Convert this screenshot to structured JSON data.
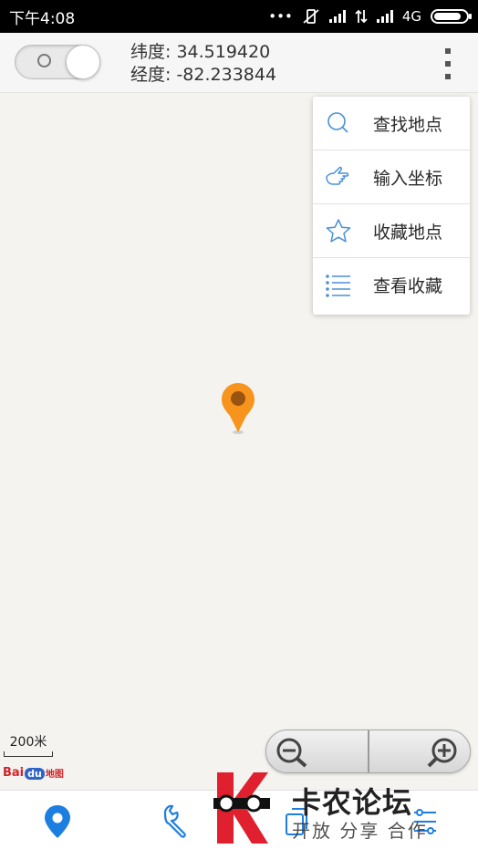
{
  "status_bar": {
    "time": "下午4:08",
    "network": "4G",
    "battery_level": 0.85
  },
  "top_bar": {
    "toggle_label": "O",
    "latitude_text": "纬度: 34.519420",
    "longitude_text": "经度: -82.233844"
  },
  "menu": {
    "items": [
      {
        "label": "查找地点",
        "icon": "search-icon"
      },
      {
        "label": "输入坐标",
        "icon": "pointing-hand-icon"
      },
      {
        "label": "收藏地点",
        "icon": "star-icon"
      },
      {
        "label": "查看收藏",
        "icon": "list-icon"
      }
    ]
  },
  "map": {
    "scale_label": "200米",
    "logo_bai": "Bai",
    "logo_du": "du",
    "logo_map": "地图",
    "marker_color": "#f7941d"
  },
  "bottom_nav": {
    "items": [
      {
        "icon": "location-pin-icon",
        "active": true
      },
      {
        "icon": "wrench-icon",
        "active": false
      },
      {
        "icon": "copy-icon",
        "active": false
      },
      {
        "icon": "filter-list-icon",
        "active": false
      }
    ],
    "accent_color": "#1c7fe0"
  },
  "watermark": {
    "title": "卡农论坛",
    "subtitle": "开放 分享 合作"
  }
}
